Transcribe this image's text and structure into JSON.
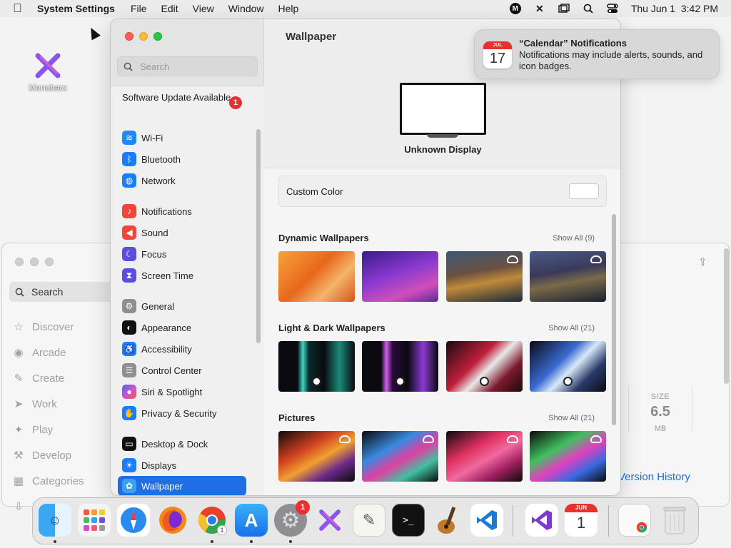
{
  "menubar": {
    "app_name": "System Settings",
    "menus": [
      "File",
      "Edit",
      "View",
      "Window",
      "Help"
    ],
    "clock": "Thu Jun 1  3:42 PM"
  },
  "desktop_icon": {
    "label": "Menubarx"
  },
  "bg_window": {
    "search": "Search",
    "nav": [
      "Discover",
      "Arcade",
      "Create",
      "Work",
      "Play",
      "Develop",
      "Categories"
    ],
    "size_label": "SIZE",
    "size_value": "6.5",
    "size_unit": "MB",
    "version_link": "Version History"
  },
  "sidebar": {
    "search_placeholder": "Search",
    "update_label": "Software Update Available",
    "update_count": "1",
    "items": [
      {
        "label": "Wi-Fi",
        "color": "#1a8cff",
        "icon": "wifi-icon"
      },
      {
        "label": "Bluetooth",
        "color": "#1a7cff",
        "icon": "bluetooth-icon"
      },
      {
        "label": "Network",
        "color": "#1a7cff",
        "icon": "globe-icon"
      },
      {
        "label": "Notifications",
        "color": "#f0463c",
        "icon": "bell-icon"
      },
      {
        "label": "Sound",
        "color": "#f0463c",
        "icon": "speaker-icon"
      },
      {
        "label": "Focus",
        "color": "#5b4de0",
        "icon": "moon-icon"
      },
      {
        "label": "Screen Time",
        "color": "#5b4de0",
        "icon": "hourglass-icon"
      },
      {
        "label": "General",
        "color": "#8e8e93",
        "icon": "gear-icon"
      },
      {
        "label": "Appearance",
        "color": "#111111",
        "icon": "appearance-icon"
      },
      {
        "label": "Accessibility",
        "color": "#1a7cff",
        "icon": "accessibility-icon"
      },
      {
        "label": "Control Center",
        "color": "#8e8e93",
        "icon": "control-center-icon"
      },
      {
        "label": "Siri & Spotlight",
        "color": "#b14fd8",
        "icon": "siri-icon"
      },
      {
        "label": "Privacy & Security",
        "color": "#1a7cff",
        "icon": "hand-icon"
      },
      {
        "label": "Desktop & Dock",
        "color": "#111111",
        "icon": "dock-icon"
      },
      {
        "label": "Displays",
        "color": "#1a7cff",
        "icon": "display-icon"
      },
      {
        "label": "Wallpaper",
        "color": "#3aa0f0",
        "icon": "wallpaper-icon"
      }
    ]
  },
  "main": {
    "title": "Wallpaper",
    "display_name": "Unknown Display",
    "custom_color_label": "Custom Color",
    "sections": [
      {
        "title": "Dynamic Wallpapers",
        "show_all": "Show All (9)"
      },
      {
        "title": "Light & Dark Wallpapers",
        "show_all": "Show All (21)"
      },
      {
        "title": "Pictures",
        "show_all": "Show All (21)"
      }
    ]
  },
  "notification": {
    "title": "“Calendar” Notifications",
    "body": "Notifications may include alerts, sounds, and icon badges.",
    "cal_month": "JUL",
    "cal_day": "17"
  },
  "dock": {
    "settings_badge": "1",
    "chrome_count": "1",
    "calendar_month": "JUN",
    "calendar_day": "1"
  }
}
